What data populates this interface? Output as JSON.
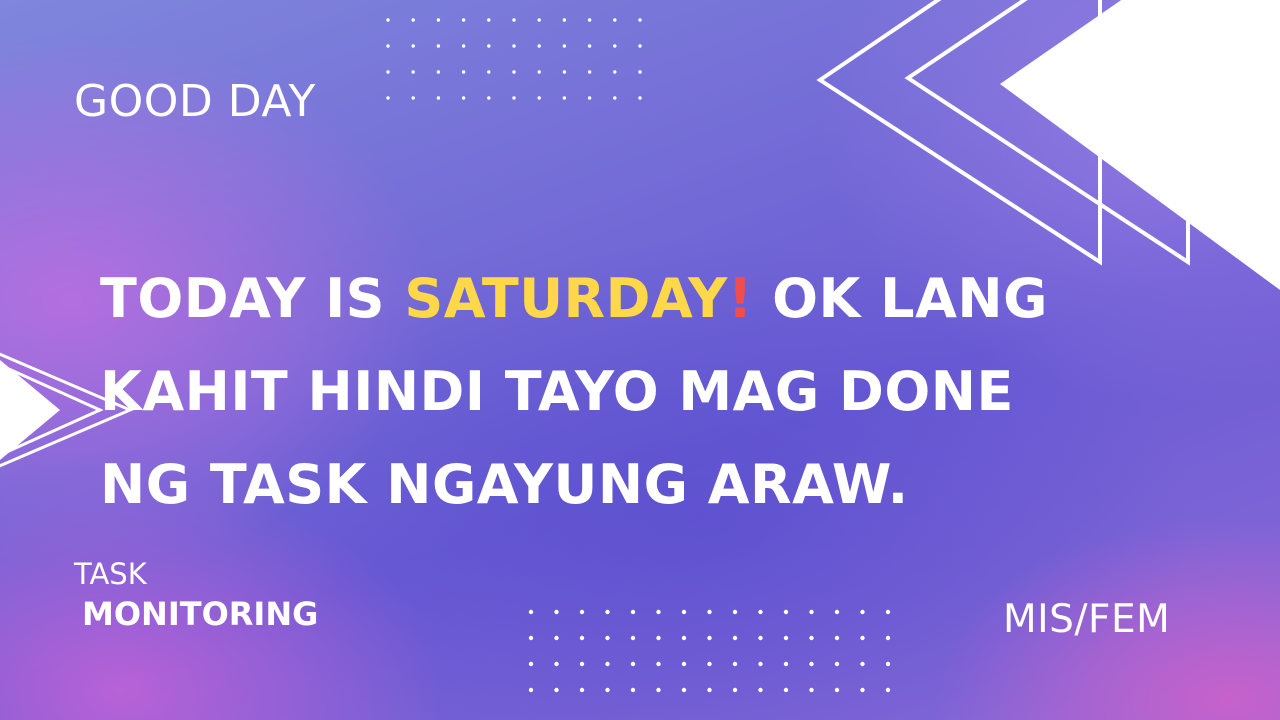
{
  "slide": {
    "greeting": "GOOD DAY",
    "headline": {
      "before": "TODAY IS ",
      "highlight": "SATURDAY",
      "exclaim": "!",
      "line1_after": " OK LANG",
      "line2": "KAHIT HINDI TAYO MAG DONE",
      "line3": "NG TASK NGAYUNG ARAW."
    },
    "footer_left_top": "TASK",
    "footer_left_bottom": "MONITORING",
    "footer_right": "MIS/FEM"
  },
  "colors": {
    "text": "#ffffff",
    "highlight": "#ffd84a",
    "exclaim": "#f04e4e"
  }
}
